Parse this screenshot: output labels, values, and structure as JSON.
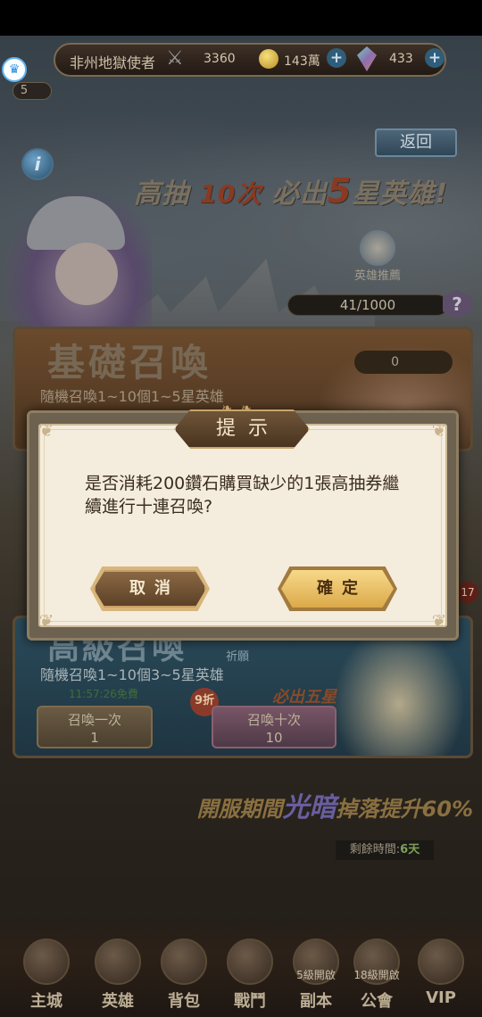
{
  "status": {
    "player_name": "非州地獄使者",
    "power": "3360",
    "gold": "143萬",
    "gems": "433",
    "level": "5"
  },
  "icons": {
    "swords": "crossed-swords-icon",
    "coin": "gold-coin-icon",
    "gem": "gem-icon",
    "plus": "plus-icon",
    "crown": "crown-icon",
    "info": "info-icon",
    "help": "question-icon"
  },
  "header": {
    "back_label": "返回",
    "info_label": "i",
    "banner_pre": "高抽",
    "banner_count": "10次",
    "banner_mid": "必出",
    "banner_star": "5",
    "banner_post": "星英雄!"
  },
  "hero_recommend": {
    "label": "英雄推薦",
    "progress": "41/1000",
    "help_glyph": "?"
  },
  "basic_summon": {
    "title": "基礎召喚",
    "desc": "隨機召喚1~10個1~5星英雄",
    "ticket_count": "0"
  },
  "advanced_summon": {
    "title": "高級召喚",
    "desc": "隨機召喚1~10個3~5星英雄",
    "timer": "11:57:26免費",
    "summon_one_label": "召喚一次",
    "summon_one_cost": "1",
    "summon_ten_label": "召喚十次",
    "summon_ten_cost": "10",
    "discount": "9折",
    "must_five": "必出五星",
    "pray_tag": "祈願"
  },
  "side_badge": "17",
  "promo": {
    "pre": "開服期間",
    "highlight": "光暗",
    "post": "掉落提升60%",
    "remaining_label": "剩餘時間:",
    "remaining_value": "6天"
  },
  "bottom_nav": [
    {
      "label": "主城",
      "lock": ""
    },
    {
      "label": "英雄",
      "lock": ""
    },
    {
      "label": "背包",
      "lock": ""
    },
    {
      "label": "戰鬥",
      "lock": ""
    },
    {
      "label": "副本",
      "lock": "5級開啟"
    },
    {
      "label": "公會",
      "lock": "18級開啟"
    },
    {
      "label": "VIP",
      "lock": ""
    }
  ],
  "dialog": {
    "title": "提示",
    "message": "是否消耗200鑽石購買缺少的1張高抽券繼續進行十連召喚?",
    "cancel_label": "取消",
    "confirm_label": "確定"
  }
}
